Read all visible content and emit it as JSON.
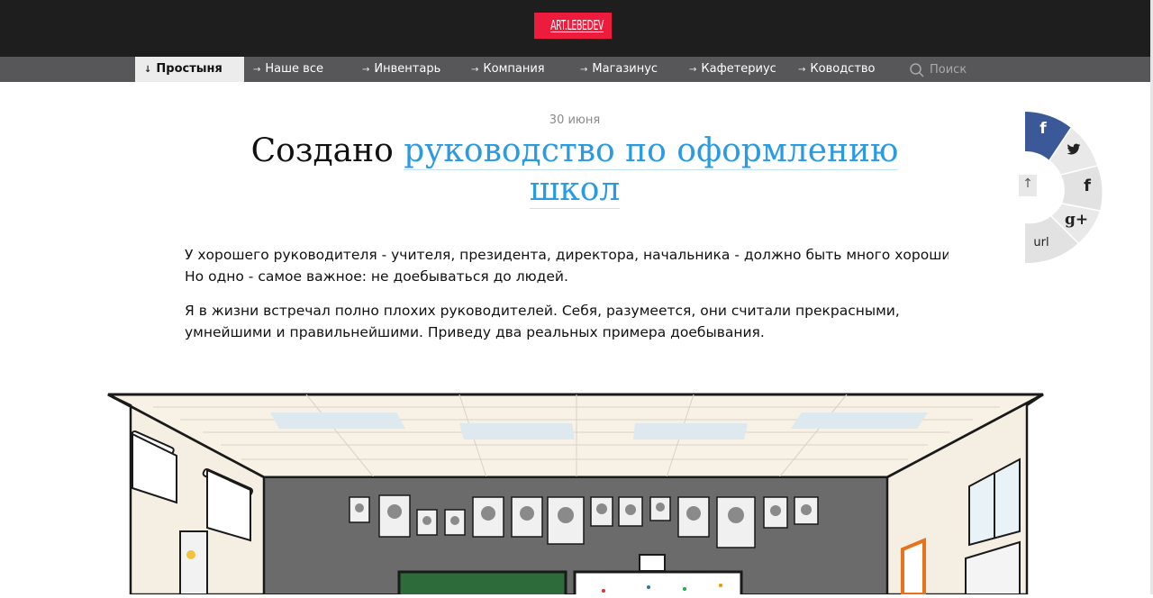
{
  "header": {
    "logo_text": "ART.LEBEDEV",
    "logo_color": "#ed1b3c",
    "bg_color": "#1f1e1f"
  },
  "nav": {
    "items": [
      {
        "label": "Простыня",
        "active": true
      },
      {
        "label": "Наше все"
      },
      {
        "label": "Инвентарь"
      },
      {
        "label": "Компания"
      },
      {
        "label": "Магазинус"
      },
      {
        "label": "Кафетериус"
      },
      {
        "label": "Ководство"
      }
    ],
    "search_placeholder": "Поиск"
  },
  "article": {
    "date": "30 июня",
    "title_plain": "Создано ",
    "title_link": "руководство по оформлению школ",
    "link_color": "#2a9be3",
    "para1_line1": "У хорошего руководителя - учителя, президента, директора, начальника - должно быть много хороших качест",
    "para1_line2": "Но одно - самое важное: не доебываться до людей.",
    "para2": "Я в жизни встречал полно плохих руководителей. Себя, разумеется, они считали прекрасными, умнейшими и правильнейшими. Приведу два реальных примера доебывания."
  },
  "share": {
    "facebook_color": "#3b5998",
    "items": [
      "facebook-icon",
      "twitter-icon",
      "facebook-icon",
      "google-plus-icon",
      "url"
    ],
    "url_label": "url",
    "gplus_label": "g+",
    "fb_label": "f",
    "scroll_up_label": "↑"
  },
  "illustration": {
    "subject": "classroom-drawing"
  }
}
